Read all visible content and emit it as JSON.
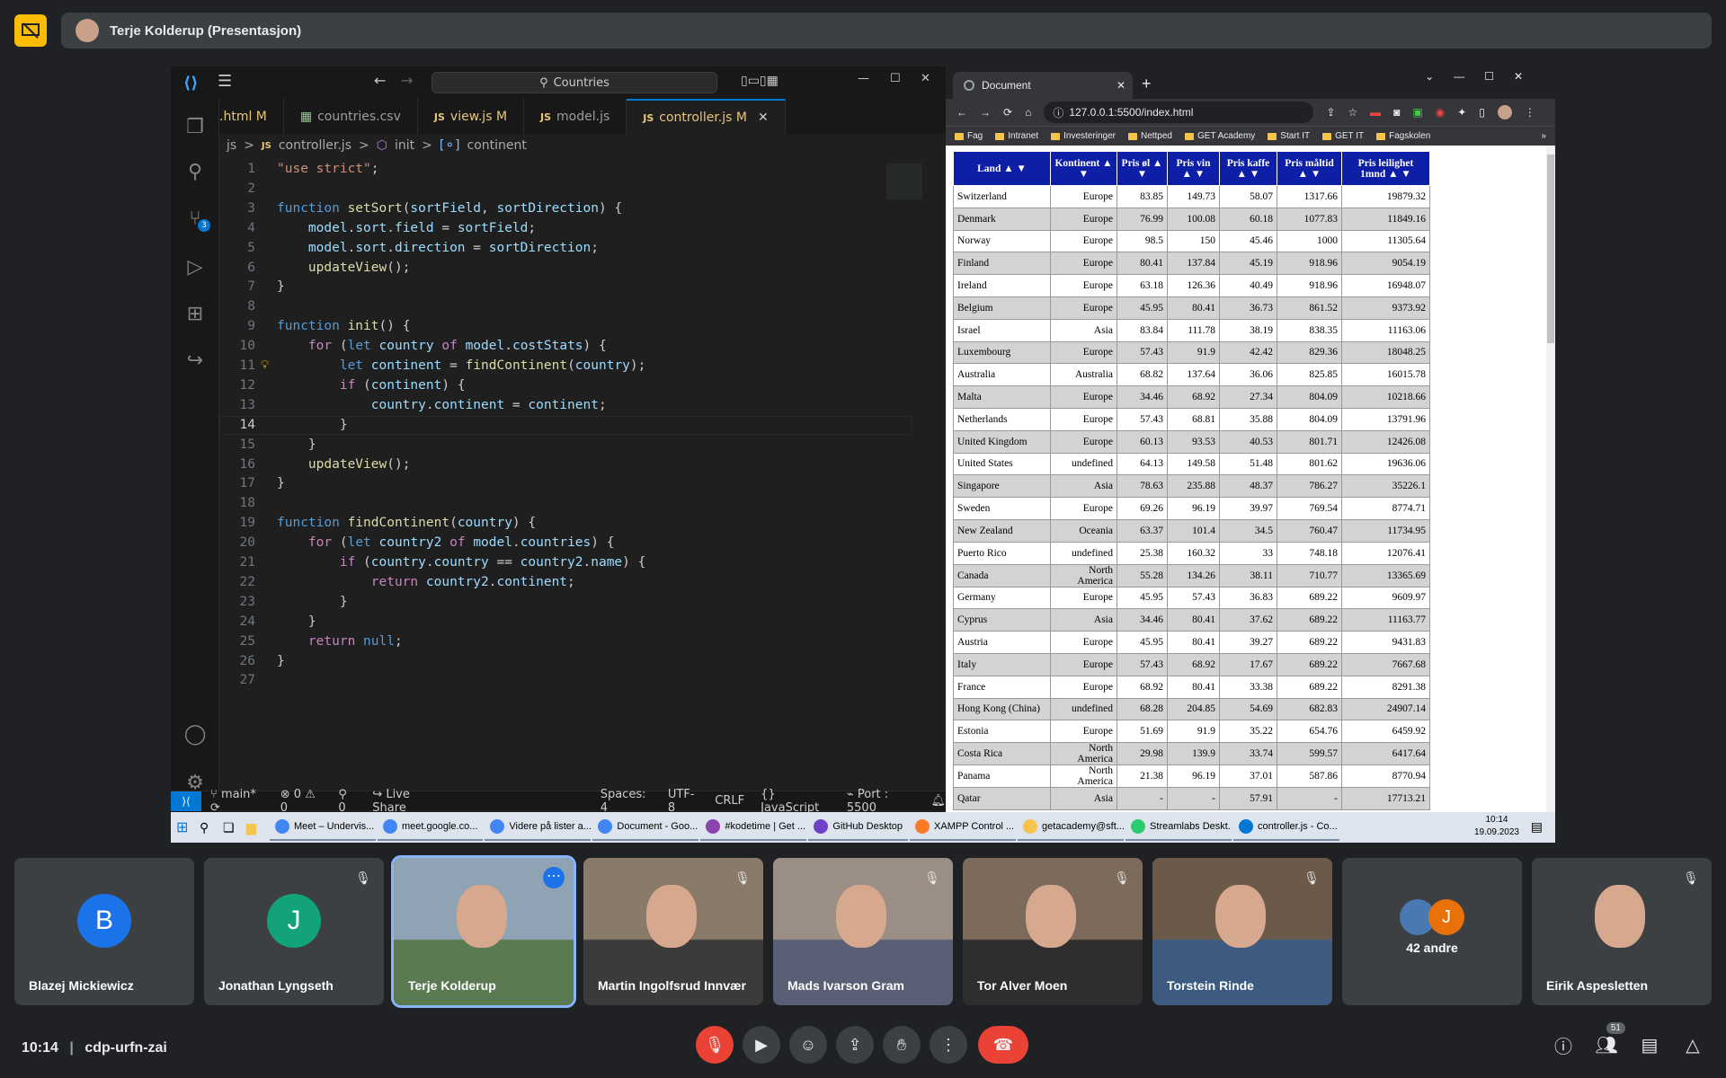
{
  "meet": {
    "presenter_label": "Terje Kolderup (Presentasjon)",
    "time": "10:14",
    "meeting_code": "cdp-urfn-zai",
    "participant_count": "51",
    "others_label": "42 andre"
  },
  "participants": [
    {
      "name": "Blazej Mickiewicz",
      "initial": "B",
      "color": "#1a73e8"
    },
    {
      "name": "Jonathan Lyngseth",
      "initial": "J",
      "color": "#12a37a"
    },
    {
      "name": "Terje Kolderup",
      "initial": "",
      "color": ""
    },
    {
      "name": "Martin Ingolfsrud Innvær",
      "initial": "",
      "color": ""
    },
    {
      "name": "Mads Ivarson Gram",
      "initial": "",
      "color": ""
    },
    {
      "name": "Tor Alver Moen",
      "initial": "",
      "color": ""
    },
    {
      "name": "Torstein Rinde",
      "initial": "",
      "color": ""
    },
    {
      "name": "42 andre",
      "initial": "",
      "color": ""
    },
    {
      "name": "Eirik Aspesletten",
      "initial": "",
      "color": ""
    }
  ],
  "vscode": {
    "search": "Countries",
    "tabs": [
      ".html M",
      "countries.csv",
      "view.js M",
      "model.js",
      "controller.js M"
    ],
    "breadcrumb": [
      "js",
      ">",
      "controller.js",
      ">",
      "init",
      ">",
      "continent"
    ],
    "code": [
      "\"use strict\";",
      "",
      "function setSort(sortField, sortDirection) {",
      "    model.sort.field = sortField;",
      "    model.sort.direction = sortDirection;",
      "    updateView();",
      "}",
      "",
      "function init() {",
      "    for (let country of model.costStats) {",
      "        let continent = findContinent(country);",
      "        if (continent) {",
      "            country.continent = continent;",
      "        }",
      "    }",
      "    updateView();",
      "}",
      "",
      "function findContinent(country) {",
      "    for (let country2 of model.countries) {",
      "        if (country.country == country2.name) {",
      "            return country2.continent;",
      "        }",
      "    }",
      "    return null;",
      "}",
      ""
    ],
    "status": {
      "branch": "main*",
      "errors": "0",
      "warnings": "0",
      "ports": "0",
      "liveshare": "Live Share",
      "spaces": "Spaces: 4",
      "encoding": "UTF-8",
      "eol": "CRLF",
      "language": "JavaScript",
      "port": "Port : 5500",
      "scm_badge": "3"
    }
  },
  "browser": {
    "tab_title": "Document",
    "url": "127.0.0.1:5500/index.html",
    "bookmarks": [
      "Fag",
      "Intranet",
      "Investeringer",
      "Nettped",
      "GET Academy",
      "Start IT",
      "GET IT",
      "Fagskolen"
    ],
    "headers": [
      "Land ▲ ▼",
      "Kontinent ▲ ▼",
      "Pris øl ▲ ▼",
      "Pris vin ▲ ▼",
      "Pris kaffe ▲ ▼",
      "Pris måltid ▲ ▼",
      "Pris leilighet 1mnd ▲ ▼"
    ],
    "rows": [
      [
        "Switzerland",
        "Europe",
        "83.85",
        "149.73",
        "58.07",
        "1317.66",
        "19879.32"
      ],
      [
        "Denmark",
        "Europe",
        "76.99",
        "100.08",
        "60.18",
        "1077.83",
        "11849.16"
      ],
      [
        "Norway",
        "Europe",
        "98.5",
        "150",
        "45.46",
        "1000",
        "11305.64"
      ],
      [
        "Finland",
        "Europe",
        "80.41",
        "137.84",
        "45.19",
        "918.96",
        "9054.19"
      ],
      [
        "Ireland",
        "Europe",
        "63.18",
        "126.36",
        "40.49",
        "918.96",
        "16948.07"
      ],
      [
        "Belgium",
        "Europe",
        "45.95",
        "80.41",
        "36.73",
        "861.52",
        "9373.92"
      ],
      [
        "Israel",
        "Asia",
        "83.84",
        "111.78",
        "38.19",
        "838.35",
        "11163.06"
      ],
      [
        "Luxembourg",
        "Europe",
        "57.43",
        "91.9",
        "42.42",
        "829.36",
        "18048.25"
      ],
      [
        "Australia",
        "Australia",
        "68.82",
        "137.64",
        "36.06",
        "825.85",
        "16015.78"
      ],
      [
        "Malta",
        "Europe",
        "34.46",
        "68.92",
        "27.34",
        "804.09",
        "10218.66"
      ],
      [
        "Netherlands",
        "Europe",
        "57.43",
        "68.81",
        "35.88",
        "804.09",
        "13791.96"
      ],
      [
        "United Kingdom",
        "Europe",
        "60.13",
        "93.53",
        "40.53",
        "801.71",
        "12426.08"
      ],
      [
        "United States",
        "undefined",
        "64.13",
        "149.58",
        "51.48",
        "801.62",
        "19636.06"
      ],
      [
        "Singapore",
        "Asia",
        "78.63",
        "235.88",
        "48.37",
        "786.27",
        "35226.1"
      ],
      [
        "Sweden",
        "Europe",
        "69.26",
        "96.19",
        "39.97",
        "769.54",
        "8774.71"
      ],
      [
        "New Zealand",
        "Oceania",
        "63.37",
        "101.4",
        "34.5",
        "760.47",
        "11734.95"
      ],
      [
        "Puerto Rico",
        "undefined",
        "25.38",
        "160.32",
        "33",
        "748.18",
        "12076.41"
      ],
      [
        "Canada",
        "North America",
        "55.28",
        "134.26",
        "38.11",
        "710.77",
        "13365.69"
      ],
      [
        "Germany",
        "Europe",
        "45.95",
        "57.43",
        "36.83",
        "689.22",
        "9609.97"
      ],
      [
        "Cyprus",
        "Asia",
        "34.46",
        "80.41",
        "37.62",
        "689.22",
        "11163.77"
      ],
      [
        "Austria",
        "Europe",
        "45.95",
        "80.41",
        "39.27",
        "689.22",
        "9431.83"
      ],
      [
        "Italy",
        "Europe",
        "57.43",
        "68.92",
        "17.67",
        "689.22",
        "7667.68"
      ],
      [
        "France",
        "Europe",
        "68.92",
        "80.41",
        "33.38",
        "689.22",
        "8291.38"
      ],
      [
        "Hong Kong (China)",
        "undefined",
        "68.28",
        "204.85",
        "54.69",
        "682.83",
        "24907.14"
      ],
      [
        "Estonia",
        "Europe",
        "51.69",
        "91.9",
        "35.22",
        "654.76",
        "6459.92"
      ],
      [
        "Costa Rica",
        "North America",
        "29.98",
        "139.9",
        "33.74",
        "599.57",
        "6417.64"
      ],
      [
        "Panama",
        "North America",
        "21.38",
        "96.19",
        "37.01",
        "587.86",
        "8770.94"
      ],
      [
        "Qatar",
        "Asia",
        "-",
        "-",
        "57.91",
        "-",
        "17713.21"
      ]
    ]
  },
  "taskbar": {
    "items": [
      "Meet – Undervis...",
      "meet.google.co...",
      "Videre på lister a...",
      "Document - Goo...",
      "#kodetime | Get ...",
      "GitHub Desktop",
      "XAMPP Control ...",
      "getacademy@sft...",
      "Streamlabs Deskt...",
      "controller.js - Co..."
    ],
    "time": "10:14",
    "date": "19.09.2023"
  }
}
